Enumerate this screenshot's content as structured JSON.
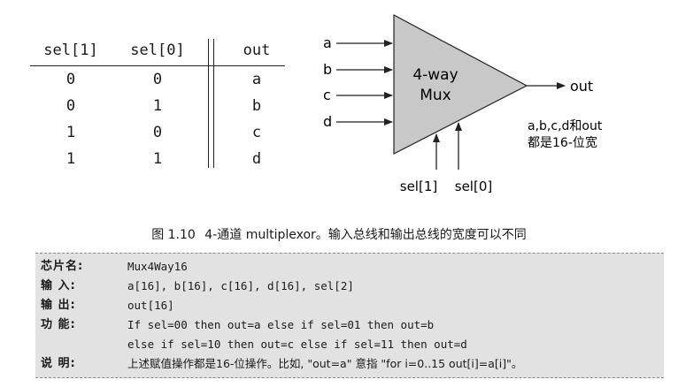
{
  "truth_table": {
    "headers": [
      "sel[1]",
      "sel[0]",
      "out"
    ],
    "rows": [
      [
        "0",
        "0",
        "a"
      ],
      [
        "0",
        "1",
        "b"
      ],
      [
        "1",
        "0",
        "c"
      ],
      [
        "1",
        "1",
        "d"
      ]
    ]
  },
  "mux": {
    "inputs": [
      "a",
      "b",
      "c",
      "d"
    ],
    "label_line1": "4-way",
    "label_line2": "Mux",
    "output": "out",
    "selects": [
      "sel[1]",
      "sel[0]"
    ],
    "note_line1": "a,b,c,d和out",
    "note_line2": "都是16-位宽",
    "fill_color": "#c8c8c8"
  },
  "caption": {
    "figure": "图 1.10",
    "text": "4-通道 multiplexor。输入总线和输出总线的宽度可以不同"
  },
  "spec": {
    "rows": [
      {
        "label": "芯片名:",
        "value": "Mux4Way16"
      },
      {
        "label": "输  入:",
        "value": "a[16], b[16], c[16], d[16], sel[2]"
      },
      {
        "label": "输  出:",
        "value": "out[16]"
      },
      {
        "label": "功  能:",
        "value": "If sel=00 then out=a else if sel=01 then out=b"
      },
      {
        "label": "",
        "value": "else if sel=10 then out=c else if sel=11 then out=d"
      },
      {
        "label": "说  明:",
        "value": "上述赋值操作都是16-位操作。比如, \"out=a\" 意指 \"for i=0..15 out[i]=a[i]\"。"
      }
    ]
  }
}
